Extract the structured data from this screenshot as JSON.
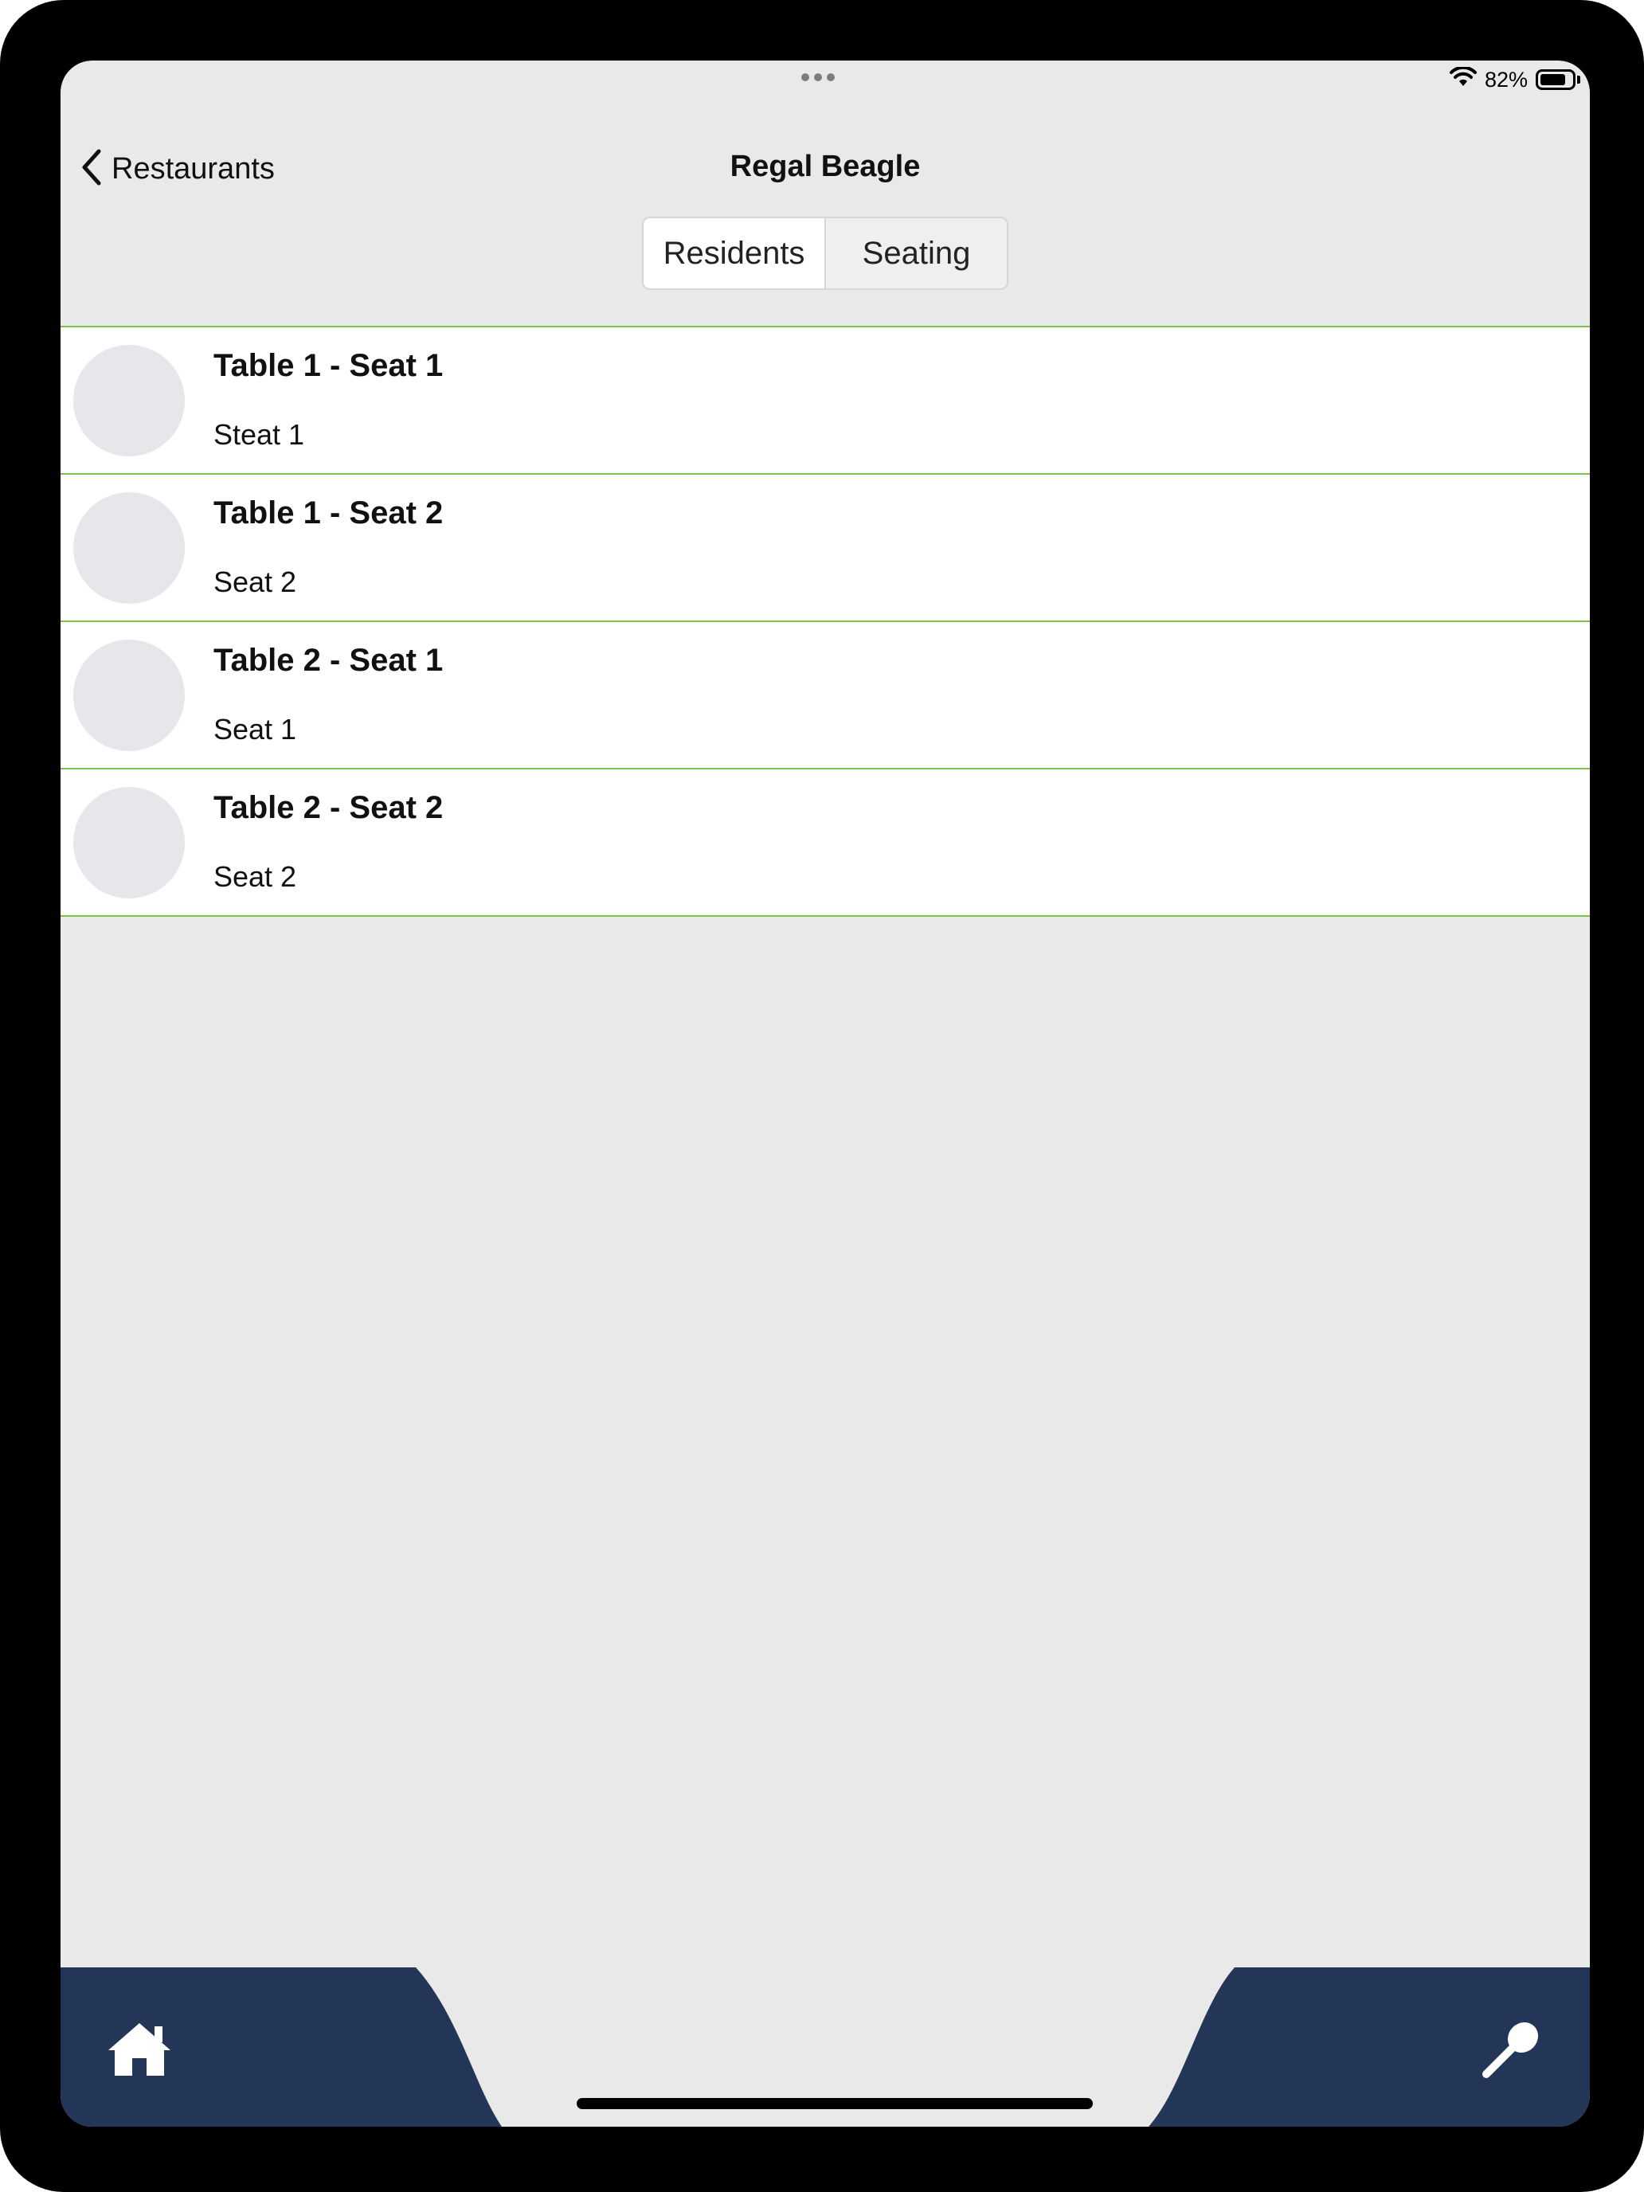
{
  "status": {
    "battery_percent": "82%",
    "battery_level": 0.82
  },
  "nav": {
    "back_label": "Restaurants",
    "title": "Regal Beagle"
  },
  "segments": [
    {
      "label": "Residents",
      "selected": true
    },
    {
      "label": "Seating",
      "selected": false
    }
  ],
  "rows": [
    {
      "title": "Table 1 - Seat 1",
      "subtitle": "Steat 1"
    },
    {
      "title": "Table 1 - Seat 2",
      "subtitle": "Seat 2"
    },
    {
      "title": "Table 2 - Seat 1",
      "subtitle": "Seat 1"
    },
    {
      "title": "Table 2 - Seat 2",
      "subtitle": "Seat 2"
    }
  ],
  "tabbar": {
    "color": "#233658",
    "left_icon": "home-icon",
    "right_icon": "spoon-icon"
  },
  "colors": {
    "row_divider": "#7fc24b",
    "background": "#e9e9e9"
  }
}
